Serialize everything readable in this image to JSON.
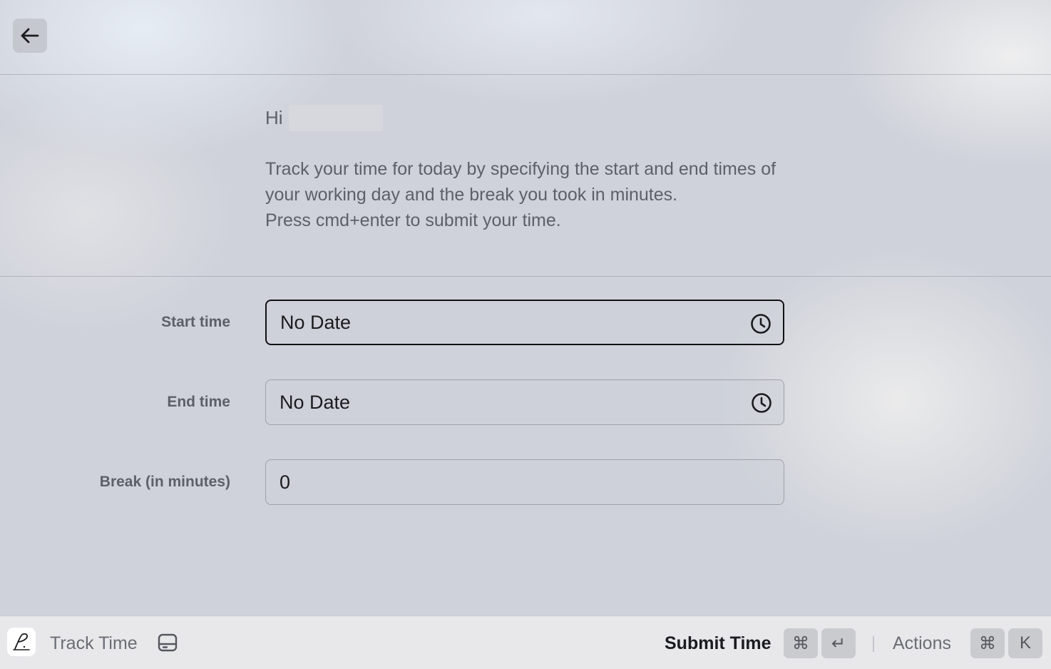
{
  "header": {
    "back_icon": "arrow-left-icon"
  },
  "intro": {
    "greeting": "Hi",
    "description_lines": [
      "Track your time for today by specifying the start and end times of your working day and the break you took in minutes.",
      "Press cmd+enter to submit your time."
    ]
  },
  "form": {
    "start_time": {
      "label": "Start time",
      "value": "No Date",
      "icon": "clock-icon"
    },
    "end_time": {
      "label": "End time",
      "value": "No Date",
      "icon": "clock-icon"
    },
    "break": {
      "label": "Break (in minutes)",
      "value": "0"
    }
  },
  "actionbar": {
    "app_icon": "signature-icon",
    "title": "Track Time",
    "storage_icon": "hard-drive-icon",
    "primary_action": "Submit Time",
    "primary_shortcut": [
      "⌘",
      "↵"
    ],
    "secondary_action": "Actions",
    "secondary_shortcut": [
      "⌘",
      "K"
    ]
  }
}
